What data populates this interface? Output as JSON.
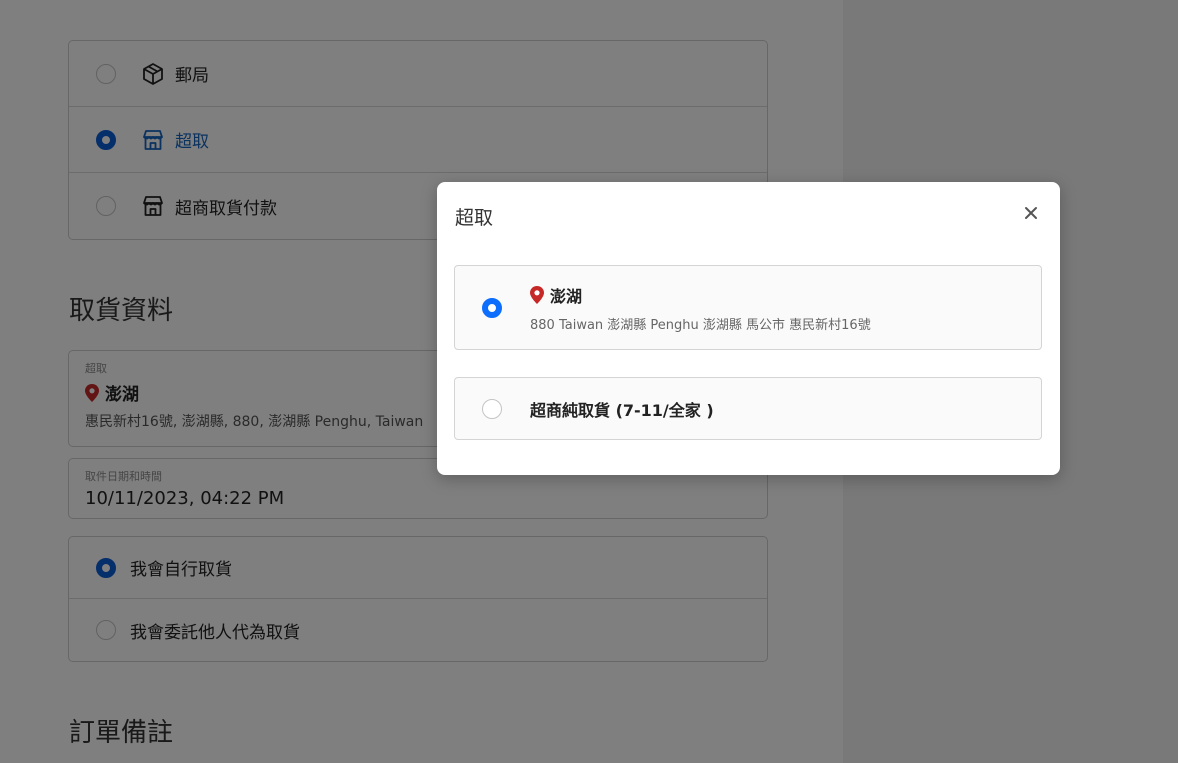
{
  "shipping_methods": [
    {
      "label": "郵局",
      "icon": "package-icon",
      "selected": false
    },
    {
      "label": "超取",
      "icon": "store-icon",
      "selected": true
    },
    {
      "label": "超商取貨付款",
      "icon": "store-icon",
      "selected": false
    }
  ],
  "pickup_section_title": "取貨資料",
  "pickup_field": {
    "small_label": "超取",
    "store_name": "澎湖",
    "address": "惠民新村16號, 澎湖縣, 880, 澎湖縣 Penghu, Taiwan"
  },
  "datetime_field": {
    "small_label": "取件日期和時間",
    "value": "10/11/2023, 04:22 PM"
  },
  "pickup_person_options": [
    {
      "label": "我會自行取貨",
      "selected": true
    },
    {
      "label": "我會委託他人代為取貨",
      "selected": false
    }
  ],
  "notes_section_title": "訂單備註",
  "modal": {
    "title": "超取",
    "close_icon": "close-icon",
    "options": [
      {
        "title": "澎湖",
        "subtitle": "880 Taiwan 澎湖縣 Penghu 澎湖縣 馬公市 惠民新村16號",
        "selected": true
      },
      {
        "title": "超商純取貨 (7-11/全家 )",
        "selected": false
      }
    ]
  },
  "colors": {
    "accent": "#0b5ed7",
    "pin_red": "#c62828",
    "overlay": "rgba(0,0,0,0.5)"
  }
}
